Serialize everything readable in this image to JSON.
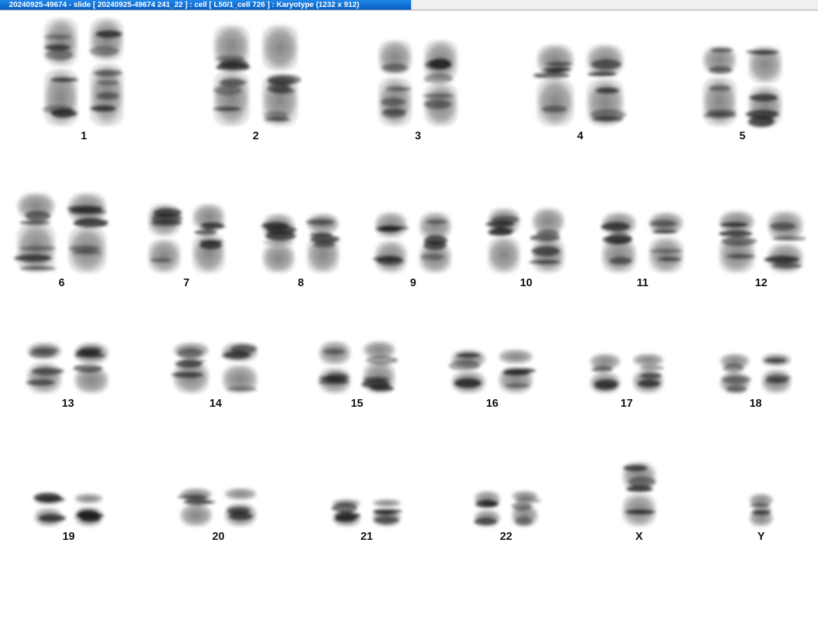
{
  "window": {
    "title": "20240925-49674 - slide [ 20240925-49674 241_22 ] : cell [ L50/1_cell 726 ] : Karyotype  (1232 x 912)"
  },
  "karyotype": {
    "chromosomes": [
      {
        "id": "1",
        "label": "1"
      },
      {
        "id": "2",
        "label": "2"
      },
      {
        "id": "3",
        "label": "3"
      },
      {
        "id": "4",
        "label": "4"
      },
      {
        "id": "5",
        "label": "5"
      },
      {
        "id": "6",
        "label": "6"
      },
      {
        "id": "7",
        "label": "7"
      },
      {
        "id": "8",
        "label": "8"
      },
      {
        "id": "9",
        "label": "9"
      },
      {
        "id": "10",
        "label": "10"
      },
      {
        "id": "11",
        "label": "11"
      },
      {
        "id": "12",
        "label": "12"
      },
      {
        "id": "13",
        "label": "13"
      },
      {
        "id": "14",
        "label": "14"
      },
      {
        "id": "15",
        "label": "15"
      },
      {
        "id": "16",
        "label": "16"
      },
      {
        "id": "17",
        "label": "17"
      },
      {
        "id": "18",
        "label": "18"
      },
      {
        "id": "19",
        "label": "19"
      },
      {
        "id": "20",
        "label": "20"
      },
      {
        "id": "21",
        "label": "21"
      },
      {
        "id": "22",
        "label": "22"
      },
      {
        "id": "X",
        "label": "X"
      },
      {
        "id": "Y",
        "label": "Y"
      }
    ]
  }
}
